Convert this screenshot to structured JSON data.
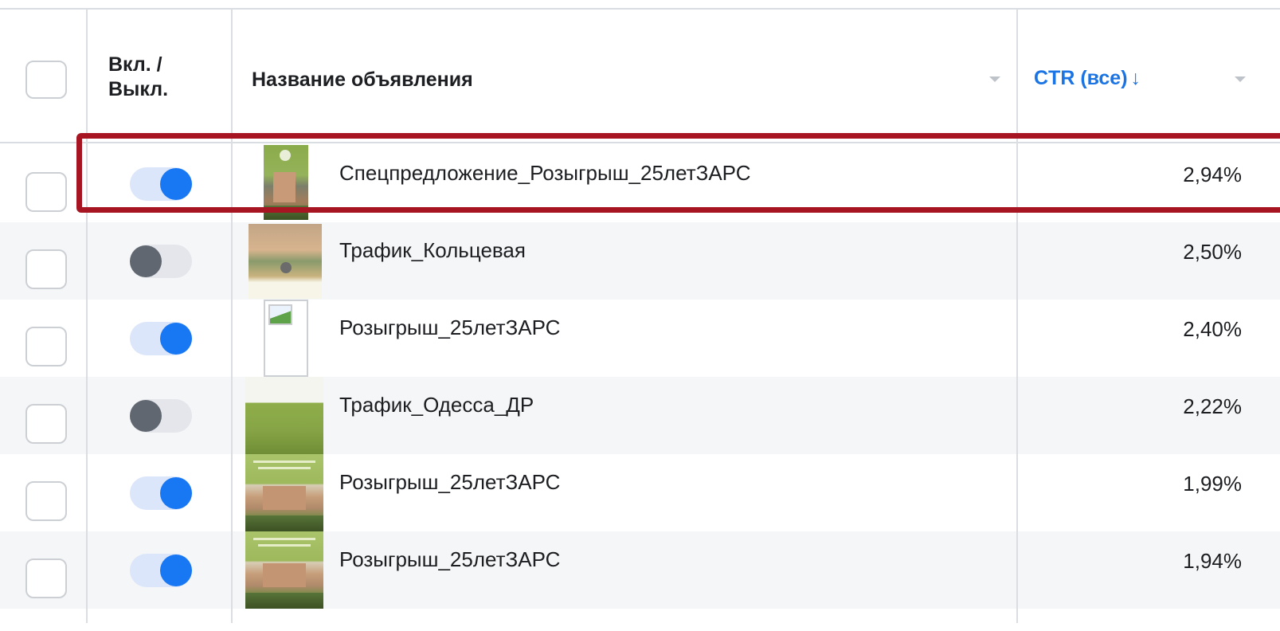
{
  "header": {
    "onoff_line1": "Вкл. /",
    "onoff_line2": "Выкл.",
    "name_label": "Название объявления",
    "ctr_label": "CTR (все)",
    "ctr_arrow": "↓"
  },
  "rows": [
    {
      "name": "Спецпредложение_Розыгрыш_25летЗАРС",
      "ctr": "2,94%",
      "on": true,
      "thumb": "green-building"
    },
    {
      "name": "Трафик_Кольцевая",
      "ctr": "2,50%",
      "on": false,
      "thumb": "garden-bridge"
    },
    {
      "name": "Розыгрыш_25летЗАРС",
      "ctr": "2,40%",
      "on": true,
      "thumb": "broken-image"
    },
    {
      "name": "Трафик_Одесса_ДР",
      "ctr": "2,22%",
      "on": false,
      "thumb": "green-field"
    },
    {
      "name": "Розыгрыш_25летЗАРС",
      "ctr": "1,99%",
      "on": true,
      "thumb": "green-building"
    },
    {
      "name": "Розыгрыш_25летЗАРС",
      "ctr": "1,94%",
      "on": true,
      "thumb": "green-building"
    }
  ],
  "colors": {
    "accent": "#1877f2",
    "highlight": "#a81522",
    "toggle_on_track": "#dbe6fb",
    "toggle_off_knob": "#606770"
  }
}
